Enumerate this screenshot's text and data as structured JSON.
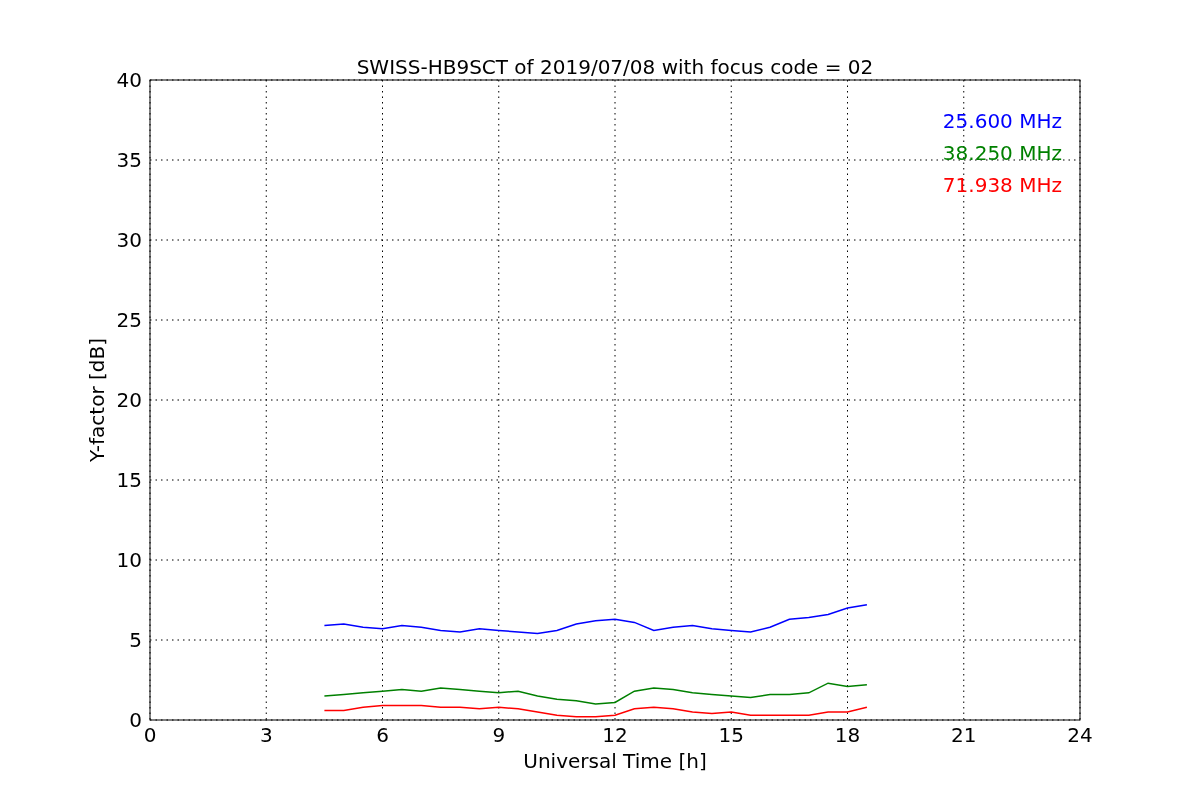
{
  "figure": {
    "chart_data": {
      "type": "line",
      "title": "SWISS-HB9SCT of 2019/07/08 with focus code = 02",
      "xlabel": "Universal Time [h]",
      "ylabel": "Y-factor [dB]",
      "x": [
        4.5,
        5,
        5.5,
        6,
        6.5,
        7,
        7.5,
        8,
        8.5,
        9,
        9.5,
        10,
        10.5,
        11,
        11.5,
        12,
        12.5,
        13,
        13.5,
        14,
        14.5,
        15,
        15.5,
        16,
        16.5,
        17,
        17.5,
        18,
        18.5
      ],
      "series": [
        {
          "name": "25.600 MHz",
          "color": "#0000ff",
          "values": [
            5.9,
            6.0,
            5.8,
            5.7,
            5.9,
            5.8,
            5.6,
            5.5,
            5.7,
            5.6,
            5.5,
            5.4,
            5.6,
            6.0,
            6.2,
            6.3,
            6.1,
            5.6,
            5.8,
            5.9,
            5.7,
            5.6,
            5.5,
            5.8,
            6.3,
            6.4,
            6.6,
            7.0,
            7.2
          ]
        },
        {
          "name": "38.250 MHz",
          "color": "#008000",
          "values": [
            1.5,
            1.6,
            1.7,
            1.8,
            1.9,
            1.8,
            2.0,
            1.9,
            1.8,
            1.7,
            1.8,
            1.5,
            1.3,
            1.2,
            1.0,
            1.1,
            1.8,
            2.0,
            1.9,
            1.7,
            1.6,
            1.5,
            1.4,
            1.6,
            1.6,
            1.7,
            2.3,
            2.1,
            2.2
          ]
        },
        {
          "name": "71.938 MHz",
          "color": "#ff0000",
          "values": [
            0.6,
            0.6,
            0.8,
            0.9,
            0.9,
            0.9,
            0.8,
            0.8,
            0.7,
            0.8,
            0.7,
            0.5,
            0.3,
            0.2,
            0.2,
            0.3,
            0.7,
            0.8,
            0.7,
            0.5,
            0.4,
            0.5,
            0.3,
            0.3,
            0.3,
            0.3,
            0.5,
            0.5,
            0.8
          ]
        }
      ],
      "xlim": [
        0,
        24
      ],
      "ylim": [
        0,
        40
      ],
      "xticks": [
        0,
        3,
        6,
        9,
        12,
        15,
        18,
        21,
        24
      ],
      "yticks": [
        0,
        5,
        10,
        15,
        20,
        25,
        30,
        35,
        40
      ],
      "grid": true
    }
  }
}
